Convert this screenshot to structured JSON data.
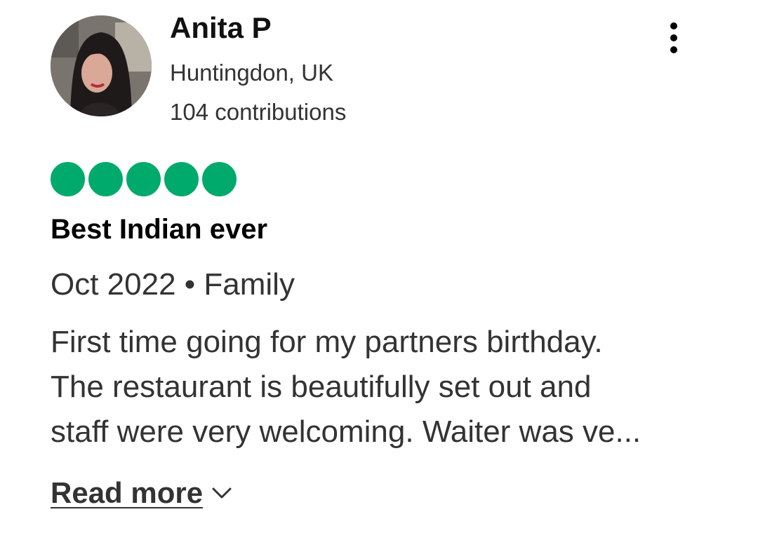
{
  "author": {
    "name": "Anita P",
    "location": "Huntingdon, UK",
    "contributions": "104 contributions"
  },
  "rating": {
    "value": 5,
    "max": 5,
    "color": "#00aa6c"
  },
  "review": {
    "title": "Best Indian ever",
    "meta": "Oct 2022 • Family",
    "body_lines": [
      "First time going for my partners birthday.",
      "The restaurant is beautifully set out and",
      "staff were very welcoming. Waiter was ve..."
    ]
  },
  "actions": {
    "more_options_icon": "more-vertical-icon",
    "read_more_label": "Read more",
    "read_more_icon": "chevron-down-icon"
  }
}
